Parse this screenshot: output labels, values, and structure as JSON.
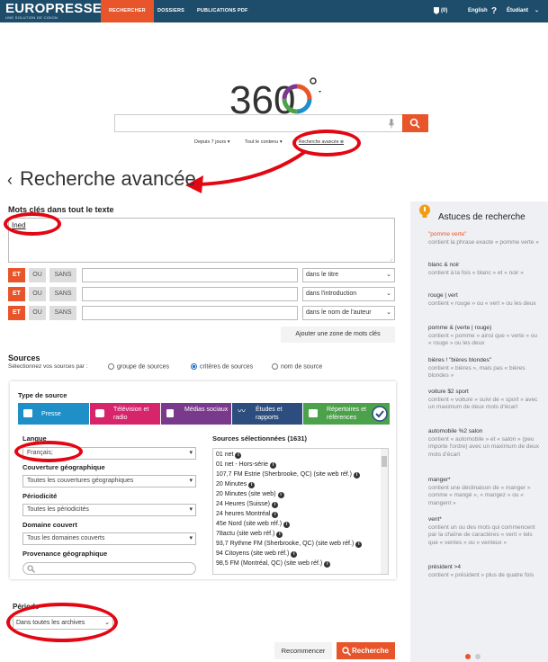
{
  "brand": {
    "logo": "EUROPRESSE",
    "tagline": "UNE SOLUTION DE CISION"
  },
  "nav": {
    "items": [
      "RECHERCHER",
      "DOSSIERS",
      "PUBLICATIONS PDF"
    ]
  },
  "topright": {
    "pins": "(0)",
    "lang": "English",
    "help": "?",
    "user": "Étudiant"
  },
  "quicksearch": {
    "logo_text": "360",
    "period": "Depuis 7 jours",
    "content": "Tout le contenu",
    "advanced_link": "Recherche avancée"
  },
  "page_title": "Recherche avancée",
  "keywords": {
    "label": "Mots clés dans tout le texte",
    "text_value": "Ined",
    "ops": [
      "ET",
      "OU",
      "SANS"
    ],
    "rows": [
      {
        "field": "dans le titre"
      },
      {
        "field": "dans l'introduction"
      },
      {
        "field": "dans le nom de l'auteur"
      }
    ],
    "add_zone": "Ajouter une zone de mots clés"
  },
  "sources": {
    "label": "Sources",
    "select_prompt": "Sélectionnez vos sources par :",
    "radios": [
      "groupe de sources",
      "critères de sources",
      "nom de source"
    ],
    "type_label": "Type de source",
    "types": [
      {
        "label": "Presse",
        "color": "#1f8fc8"
      },
      {
        "label": "Télévision et radio",
        "color": "#d6256b"
      },
      {
        "label": "Médias sociaux",
        "color": "#7a3a8c"
      },
      {
        "label": "Études et rapports",
        "color": "#2c4d7e"
      },
      {
        "label": "Répertoires et références",
        "color": "#4ca24a"
      }
    ],
    "langue_label": "Langue",
    "langue_value": "Français;",
    "couverture_label": "Couverture géographique",
    "couverture_value": "Toutes les couvertures géographiques",
    "periodicite_label": "Périodicité",
    "periodicite_value": "Toutes les périodicités",
    "domaine_label": "Domaine couvert",
    "domaine_value": "Tous les domaines couverts",
    "provenance_label": "Provenance géographique",
    "selected_label": "Sources sélectionnées (1631)",
    "selected": [
      "01 net",
      "01 net - Hors-série",
      "107,7 FM Estrie (Sherbrooke, QC) (site web réf.)",
      "20 Minutes",
      "20 Minutes (site web)",
      "24 Heures (Suisse)",
      "24 heures Montréal",
      "45e Nord (site web réf.)",
      "78actu (site web réf.)",
      "93,7 Rythme FM (Sherbrooke, QC) (site web réf.)",
      "94 Citoyens (site web réf.)",
      "98,5 FM (Montréal, QC) (site web réf.)"
    ]
  },
  "periode": {
    "label": "Période",
    "value": "Dans toutes les archives"
  },
  "actions": {
    "reset": "Recommencer",
    "search": "Recherche"
  },
  "tips": {
    "title": "Astuces de recherche",
    "items": [
      {
        "a": "\"pomme verte\"",
        "b": "contient la phrase exacte « pomme verte »"
      },
      {
        "a": "blanc & noir",
        "b": "contient à la fois « blanc » et « noir »"
      },
      {
        "a": "rouge | vert",
        "b": "contient « rouge » ou « vert » ou les deux"
      },
      {
        "a": "pomme & (verte | rouge)",
        "b": "contient « pomme » ainsi que « verte » ou « rouge » ou les deux"
      },
      {
        "a": "bières ! \"bières blondes\"",
        "b": "contient « bières », mais pas « bières blondes »"
      },
      {
        "a": "voiture $2 sport",
        "b": "contient « voiture » suivi de « sport » avec un maximum de deux mots d'écart"
      },
      {
        "a": "automobile %2 salon",
        "b": "contient « automobile » et « salon » (peu importe l'ordre) avec un maximum de deux mots d'écart"
      },
      {
        "a": "manger*",
        "b": "contient une déclinaison de « manger » comme « mangé », « mangez » ou « mangent »"
      },
      {
        "a": "vent*",
        "b": "contient un ou des mots qui commencent par la chaîne de caractères « vent » tels que « ventes » ou « venteux »"
      },
      {
        "a": "président >4",
        "b": "contient « président » plus de quatre fois"
      }
    ]
  },
  "colors": {
    "accent": "#e8552a",
    "topbar": "#1e4d6b",
    "annotation": "#e30613"
  }
}
